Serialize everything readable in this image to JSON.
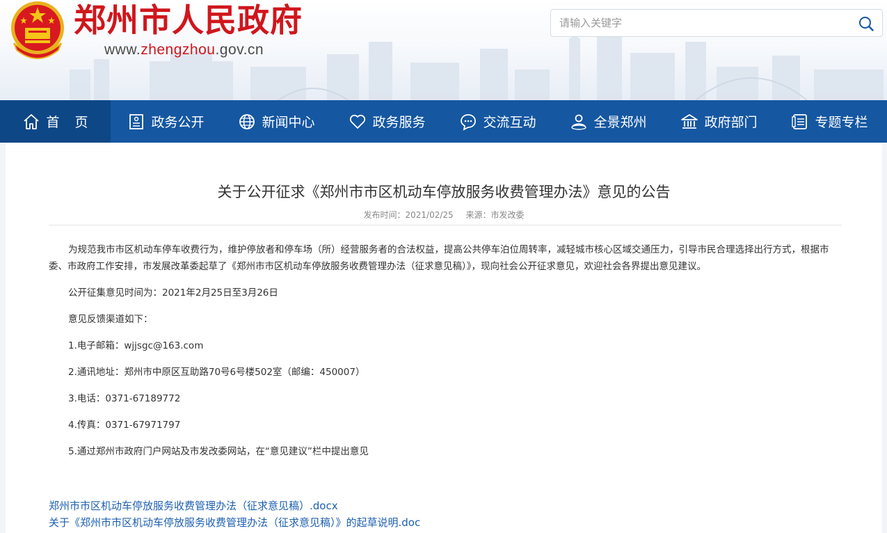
{
  "header": {
    "site_title": "郑州市人民政府",
    "url_prefix": "www.",
    "url_highlight": "zhengzhou",
    "url_suffix": ".gov.cn"
  },
  "search": {
    "placeholder": "请输入关键字",
    "icon": "search-icon"
  },
  "nav": {
    "items": [
      {
        "label": "首页",
        "icon": "home-icon"
      },
      {
        "label": "政务公开",
        "icon": "document-icon"
      },
      {
        "label": "新闻中心",
        "icon": "globe-icon"
      },
      {
        "label": "政务服务",
        "icon": "heart-icon"
      },
      {
        "label": "交流互动",
        "icon": "chat-icon"
      },
      {
        "label": "全景郑州",
        "icon": "user-location-icon"
      },
      {
        "label": "政府部门",
        "icon": "government-building-icon"
      },
      {
        "label": "专题专栏",
        "icon": "list-icon"
      }
    ]
  },
  "article": {
    "title": "关于公开征求《郑州市市区机动车停放服务收费管理办法》意见的公告",
    "publish_time": "发布时间：2021/02/25",
    "source": "来源：市发改委",
    "paragraphs": [
      "为规范我市市区机动车停车收费行为，维护停放者和停车场（所）经营服务者的合法权益，提高公共停车泊位周转率，减轻城市核心区域交通压力，引导市民合理选择出行方式，根据市委、市政府工作安排，市发展改革委起草了《郑州市市区机动车停放服务收费管理办法（征求意见稿）》，现向社会公开征求意见，欢迎社会各界提出意见建议。",
      "公开征集意见时间为：2021年2月25日至3月26日",
      "意见反馈渠道如下：",
      "1.电子邮箱：wjjsgc@163.com",
      "2.通讯地址：郑州市中原区互助路70号6号楼502室（邮编：450007）",
      "3.电话：0371-67189772",
      "4.传真：0371-67971797",
      "5.通过郑州市政府门户网站及市发改委网站，在“意见建议”栏中提出意见"
    ],
    "attachments": [
      "郑州市市区机动车停放服务收费管理办法（征求意见稿）.docx",
      "关于《郑州市市区机动车停放服务收费管理办法（征求意见稿）》的起草说明.doc"
    ]
  },
  "colors": {
    "brand_red": "#d0161c",
    "nav_blue": "#1557a1",
    "nav_active": "#0d4786",
    "link_blue": "#1d5fb0"
  }
}
